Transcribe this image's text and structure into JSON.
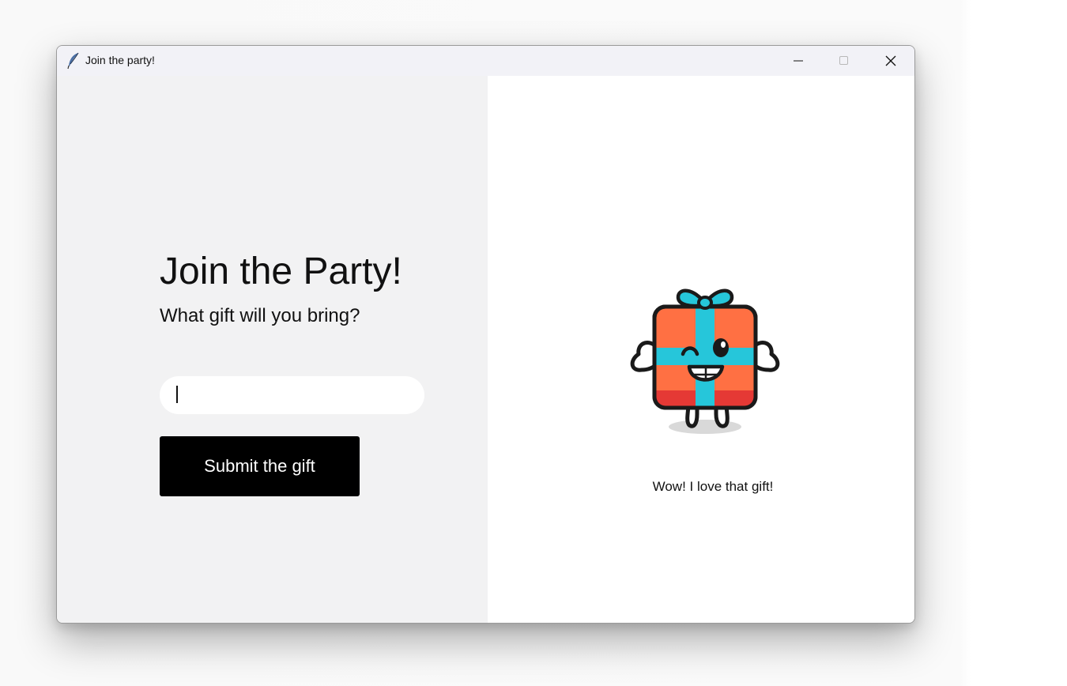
{
  "window": {
    "title": "Join the party!",
    "app_icon": "feather-icon"
  },
  "titlebar": {
    "minimize_icon": "minimize-icon",
    "maximize_icon": "maximize-icon",
    "close_icon": "close-icon"
  },
  "form": {
    "heading": "Join the Party!",
    "subheading": "What gift will you bring?",
    "gift_input": {
      "value": "",
      "placeholder": ""
    },
    "submit_label": "Submit the gift"
  },
  "preview": {
    "mascot": "gift-box-mascot",
    "reply": "Wow! I love that gift!"
  },
  "colors": {
    "button_bg": "#000000",
    "button_text": "#ffffff",
    "left_pane_bg": "#f2f2f3",
    "right_pane_bg": "#ffffff",
    "gift_box": "#ff7043",
    "ribbon": "#26c6da"
  }
}
